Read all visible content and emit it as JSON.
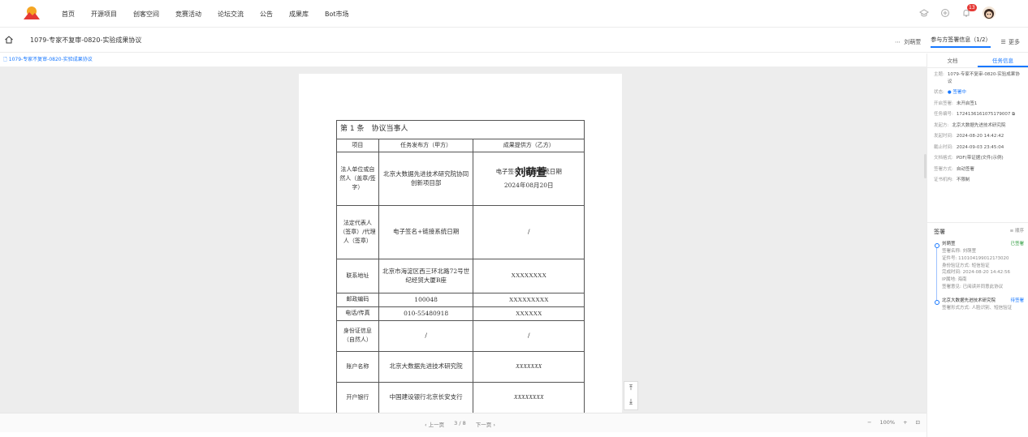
{
  "nav": {
    "items": [
      "首页",
      "开源项目",
      "创客空间",
      "竞赛活动",
      "论坛交流",
      "公告",
      "成果库",
      "Bot市场"
    ],
    "badge_count": "13"
  },
  "titlebar": {
    "title": "1079-专家不复审-0820-实验成果协议",
    "signer": "刘萌萱",
    "active_tab": "参与方签署信息（1/2）",
    "more": "更多"
  },
  "breadcrumb": "1079-专家不复审-0820-实验成果协议",
  "contract": {
    "section_title": "第 1 条　协议当事人",
    "col_item": "项目",
    "col_party_a": "任务发布方（甲方）",
    "col_party_b": "成果提供方（乙方）",
    "rows": [
      {
        "label": "法人单位或自然人（盖章/签字）",
        "a": "北京大数据先进技术研究院协同创新项目部",
        "b": "电子签名+链接系统日期",
        "b_sig": "刘萌萱",
        "b_date": "2024年08月20日"
      },
      {
        "label": "法定代表人（签章）/代理人（签章）",
        "a": "电子签名+链接系统日期",
        "b": "/"
      },
      {
        "label": "联系地址",
        "a": "北京市海淀区西三环北路72号世纪经贸大厦B座",
        "b": "XXXXXXXX"
      },
      {
        "label": "邮政编码",
        "a": "100048",
        "b": "XXXXXXXXX"
      },
      {
        "label": "电话/传真",
        "a": "010-55480918",
        "b": "XXXXXX"
      },
      {
        "label": "身份证信息（自然人）",
        "a": "/",
        "b": "/"
      },
      {
        "label": "账户名称",
        "a": "北京大数据先进技术研究院",
        "b": "XXXXXXX"
      },
      {
        "label": "开户银行",
        "a": "中国建设银行北京长安支行",
        "b": "XXXXXXXX"
      }
    ]
  },
  "pager": {
    "prev": "‹ 上一页",
    "page": "3 / 8",
    "next": "下一页 ›"
  },
  "zoom": {
    "minus": "−",
    "level": "100%",
    "plus": "+"
  },
  "rpanel": {
    "tabs": [
      "文档",
      "任务信息"
    ],
    "info": [
      {
        "k": "主题:",
        "v": "1079-专家不复审-0820-实验成果协议"
      },
      {
        "k": "状态:",
        "v": "● 签署中"
      },
      {
        "k": "开启签署:",
        "v": "未开启签1"
      },
      {
        "k": "任务编号:",
        "v": "1724136161075179007 ⧉"
      },
      {
        "k": "发起方:",
        "v": "北京大数据先进技术研究院"
      },
      {
        "k": "发起时间:",
        "v": "2024-08-20 14:42:42"
      },
      {
        "k": "截止时间:",
        "v": "2024-09-03 23:45:04"
      },
      {
        "k": "文档格式:",
        "v": "PDF(带证据)文件(示例)"
      },
      {
        "k": "签署方式:",
        "v": "自动签署"
      },
      {
        "k": "证书机构:",
        "v": "不限制"
      }
    ],
    "sign_title": "签署",
    "sign_right": "≡ 顺序",
    "signer1": {
      "name": "刘萌萱",
      "status": "已签署",
      "lines": [
        "签署名称: 刘萌萱",
        "证件号: 1101041990121?3020",
        "身份验证方式: 短信验证",
        "完成时间: 2024-08-20 14:42:56",
        "IP属地: 海南",
        "签署意见: 已阅读并同意此协议"
      ]
    },
    "signer2": {
      "name": "北京大数据先进技术研究院",
      "status": "待签署",
      "lines": [
        "签署形式方式: 人脸识别、短信验证"
      ]
    }
  }
}
